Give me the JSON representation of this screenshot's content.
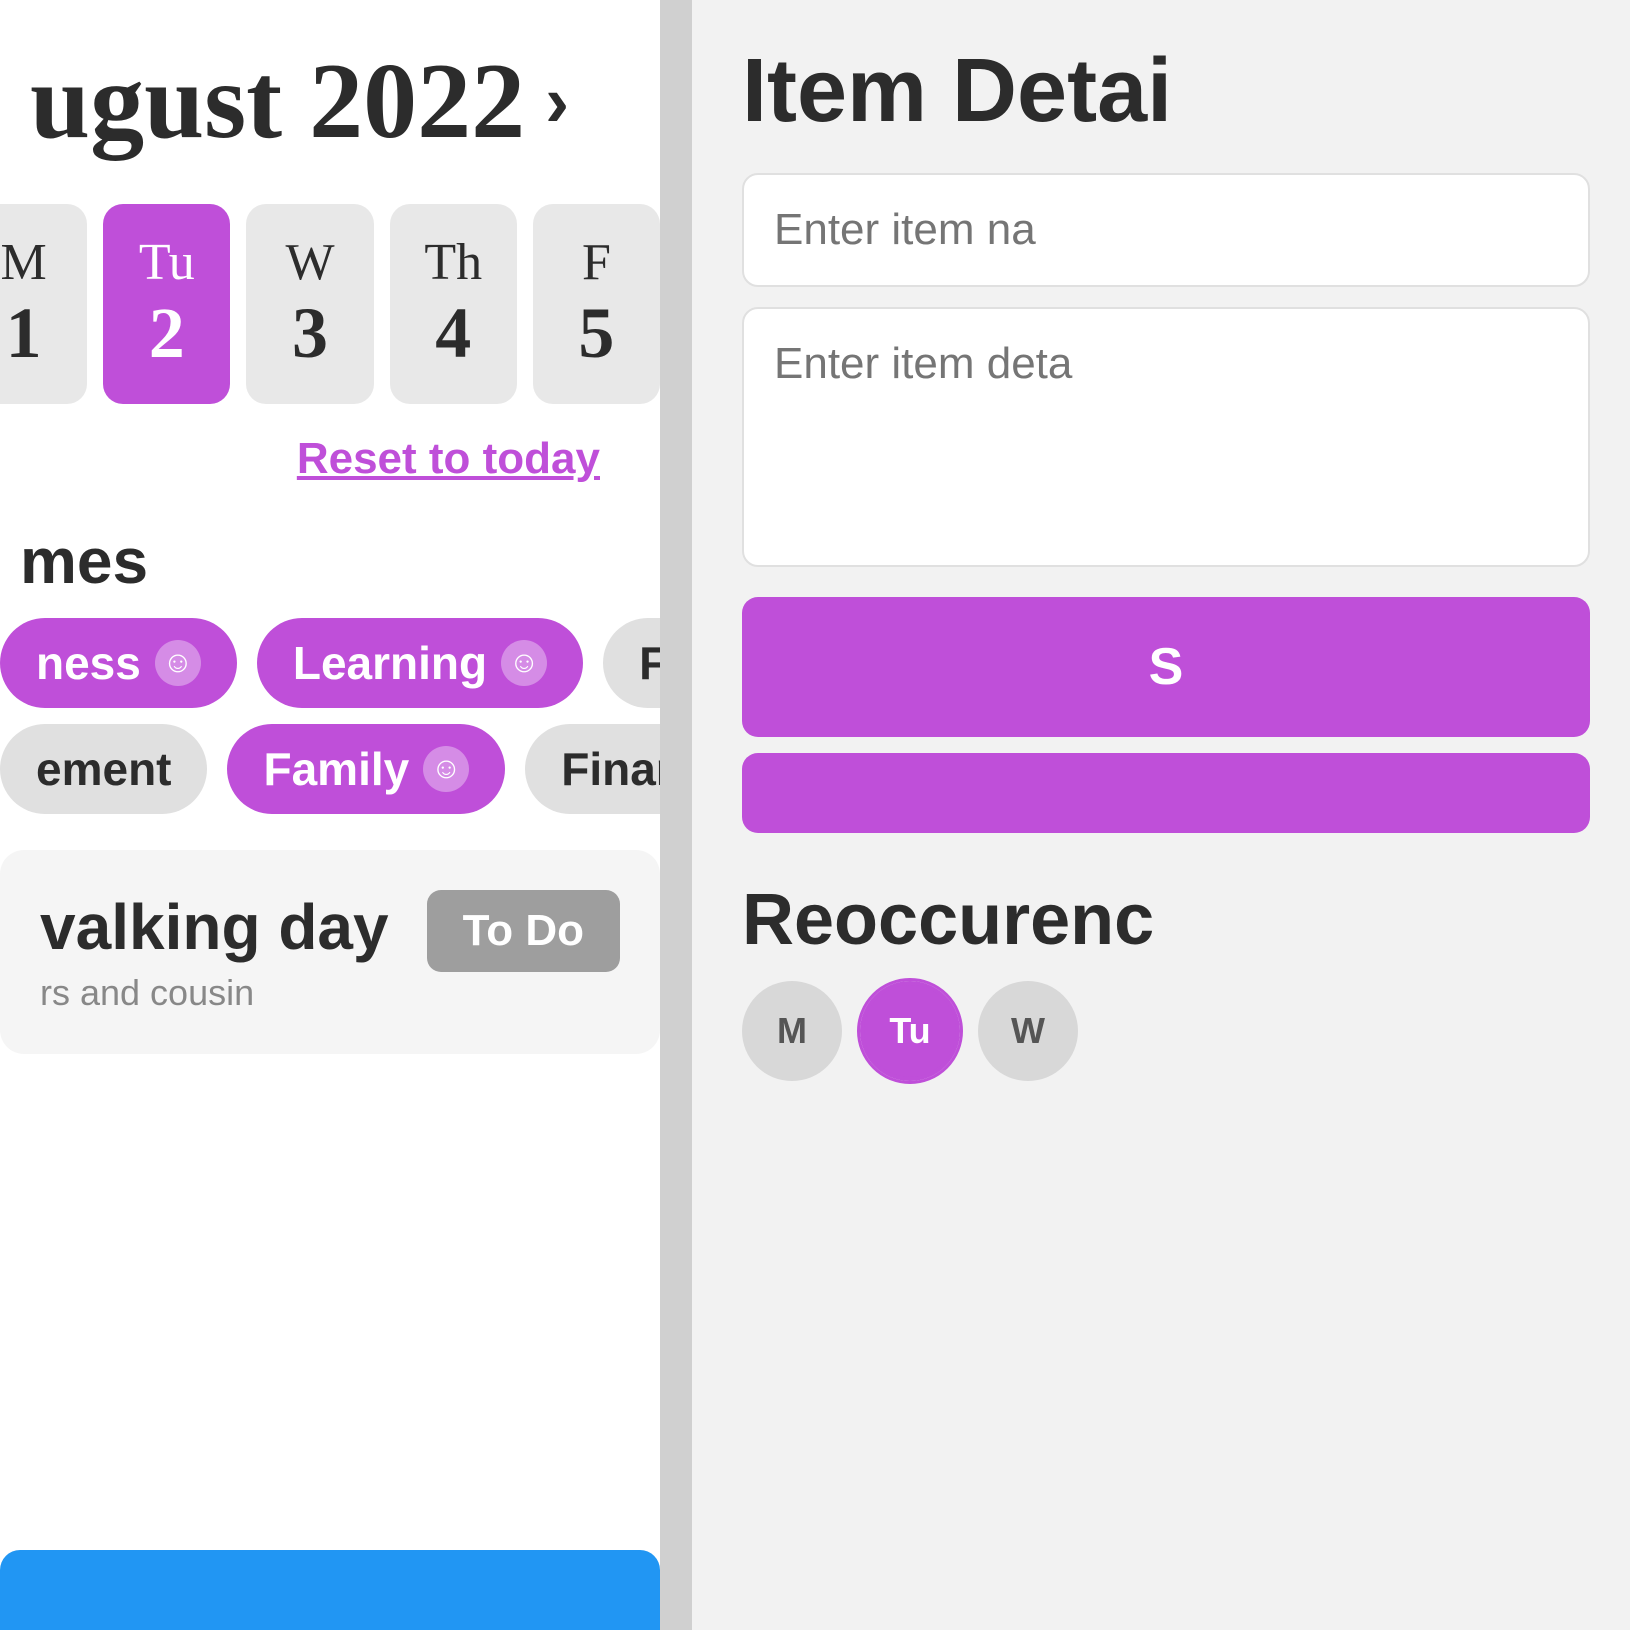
{
  "left": {
    "month_title": "ugust 2022",
    "chevron": "›",
    "days": [
      {
        "abbr": "M",
        "num": "1",
        "active": false
      },
      {
        "abbr": "Tu",
        "num": "2",
        "active": true
      },
      {
        "abbr": "W",
        "num": "3",
        "active": false
      },
      {
        "abbr": "Th",
        "num": "4",
        "active": false
      },
      {
        "abbr": "F",
        "num": "5",
        "active": false
      }
    ],
    "reset_label": "Reset to today",
    "section_label": "mes",
    "categories_row1": [
      {
        "label": "ness",
        "active": true,
        "has_smiley": true
      },
      {
        "label": "Learning",
        "active": true,
        "has_smiley": true
      },
      {
        "label": "Fun",
        "active": false,
        "has_smiley": false
      }
    ],
    "categories_row2": [
      {
        "label": "ement",
        "active": false,
        "has_smiley": false
      },
      {
        "label": "Family",
        "active": true,
        "has_smiley": true
      },
      {
        "label": "Finance",
        "active": false,
        "has_smiley": false
      }
    ],
    "task": {
      "title": "valking day",
      "desc": "rs and cousin",
      "badge": "To Do"
    }
  },
  "right": {
    "title": "Item Detai",
    "name_placeholder": "Enter item na",
    "details_placeholder": "Enter item deta",
    "btn1_label": "S",
    "btn2_label": "",
    "reoccurrence_label": "Reoccurenc",
    "days": [
      {
        "abbr": "M",
        "selected": false
      },
      {
        "abbr": "Tu",
        "selected": true
      },
      {
        "abbr": "W",
        "selected": false
      }
    ]
  },
  "icons": {
    "smiley": "☺"
  }
}
